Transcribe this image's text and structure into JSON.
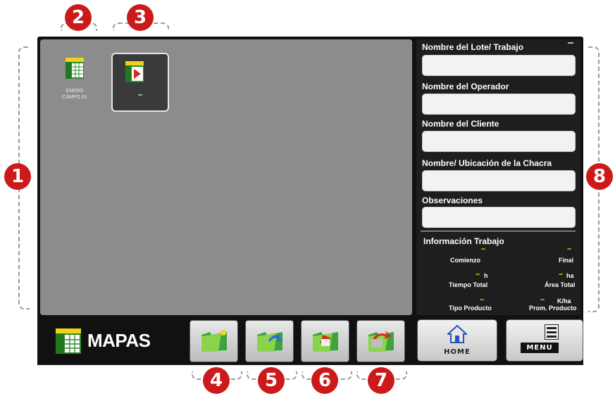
{
  "callouts": {
    "c1": "1",
    "c2": "2",
    "c3": "3",
    "c4": "4",
    "c5": "5",
    "c6": "6",
    "c7": "7",
    "c8": "8"
  },
  "map_files": [
    {
      "name_line1": "ENERO",
      "name_line2": "CAMPO 01",
      "icon": "grid-map-file-icon"
    },
    {
      "name_line1": "–",
      "icon": "play-map-file-icon",
      "selected": true
    }
  ],
  "side_panel": {
    "lote_label": "Nombre del Lote/ Trabajo",
    "operador_label": "Nombre del Operador",
    "cliente_label": "Nombre del Cliente",
    "chacra_label": "Nombre/ Ubicación de la Chacra",
    "obs_label": "Observaciones",
    "info_title": "Información Trabajo",
    "comienzo": "Comienzo",
    "final": "Final",
    "tiempo_total": "Tiempo Total",
    "tiempo_unit": "h",
    "area_total": "Área Total",
    "area_unit": "ha",
    "tipo_producto": "Tipo Producto",
    "prom_producto": "Prom. Producto",
    "prom_unit": "K/ha",
    "dash": "–"
  },
  "bottom_bar": {
    "title": "MAPAS",
    "home_label": "HOME",
    "menu_label": "MENU"
  },
  "colors": {
    "callout": "#cc1a1a",
    "map_bg": "#8c8c8c",
    "accent_yellow": "#ffea00"
  }
}
